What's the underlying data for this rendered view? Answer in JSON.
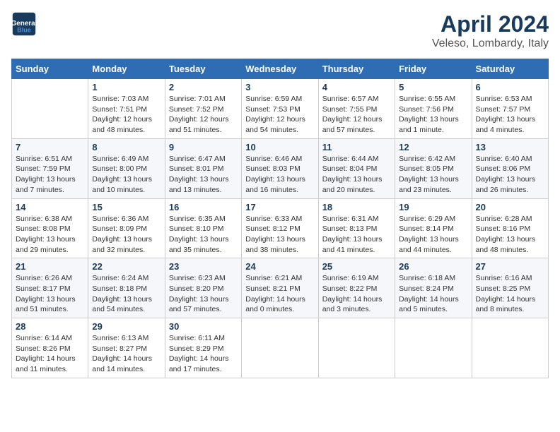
{
  "header": {
    "logo_line1": "General",
    "logo_line2": "Blue",
    "title": "April 2024",
    "subtitle": "Veleso, Lombardy, Italy"
  },
  "columns": [
    "Sunday",
    "Monday",
    "Tuesday",
    "Wednesday",
    "Thursday",
    "Friday",
    "Saturday"
  ],
  "weeks": [
    [
      {
        "day": "",
        "info": ""
      },
      {
        "day": "1",
        "info": "Sunrise: 7:03 AM\nSunset: 7:51 PM\nDaylight: 12 hours\nand 48 minutes."
      },
      {
        "day": "2",
        "info": "Sunrise: 7:01 AM\nSunset: 7:52 PM\nDaylight: 12 hours\nand 51 minutes."
      },
      {
        "day": "3",
        "info": "Sunrise: 6:59 AM\nSunset: 7:53 PM\nDaylight: 12 hours\nand 54 minutes."
      },
      {
        "day": "4",
        "info": "Sunrise: 6:57 AM\nSunset: 7:55 PM\nDaylight: 12 hours\nand 57 minutes."
      },
      {
        "day": "5",
        "info": "Sunrise: 6:55 AM\nSunset: 7:56 PM\nDaylight: 13 hours\nand 1 minute."
      },
      {
        "day": "6",
        "info": "Sunrise: 6:53 AM\nSunset: 7:57 PM\nDaylight: 13 hours\nand 4 minutes."
      }
    ],
    [
      {
        "day": "7",
        "info": "Sunrise: 6:51 AM\nSunset: 7:59 PM\nDaylight: 13 hours\nand 7 minutes."
      },
      {
        "day": "8",
        "info": "Sunrise: 6:49 AM\nSunset: 8:00 PM\nDaylight: 13 hours\nand 10 minutes."
      },
      {
        "day": "9",
        "info": "Sunrise: 6:47 AM\nSunset: 8:01 PM\nDaylight: 13 hours\nand 13 minutes."
      },
      {
        "day": "10",
        "info": "Sunrise: 6:46 AM\nSunset: 8:03 PM\nDaylight: 13 hours\nand 16 minutes."
      },
      {
        "day": "11",
        "info": "Sunrise: 6:44 AM\nSunset: 8:04 PM\nDaylight: 13 hours\nand 20 minutes."
      },
      {
        "day": "12",
        "info": "Sunrise: 6:42 AM\nSunset: 8:05 PM\nDaylight: 13 hours\nand 23 minutes."
      },
      {
        "day": "13",
        "info": "Sunrise: 6:40 AM\nSunset: 8:06 PM\nDaylight: 13 hours\nand 26 minutes."
      }
    ],
    [
      {
        "day": "14",
        "info": "Sunrise: 6:38 AM\nSunset: 8:08 PM\nDaylight: 13 hours\nand 29 minutes."
      },
      {
        "day": "15",
        "info": "Sunrise: 6:36 AM\nSunset: 8:09 PM\nDaylight: 13 hours\nand 32 minutes."
      },
      {
        "day": "16",
        "info": "Sunrise: 6:35 AM\nSunset: 8:10 PM\nDaylight: 13 hours\nand 35 minutes."
      },
      {
        "day": "17",
        "info": "Sunrise: 6:33 AM\nSunset: 8:12 PM\nDaylight: 13 hours\nand 38 minutes."
      },
      {
        "day": "18",
        "info": "Sunrise: 6:31 AM\nSunset: 8:13 PM\nDaylight: 13 hours\nand 41 minutes."
      },
      {
        "day": "19",
        "info": "Sunrise: 6:29 AM\nSunset: 8:14 PM\nDaylight: 13 hours\nand 44 minutes."
      },
      {
        "day": "20",
        "info": "Sunrise: 6:28 AM\nSunset: 8:16 PM\nDaylight: 13 hours\nand 48 minutes."
      }
    ],
    [
      {
        "day": "21",
        "info": "Sunrise: 6:26 AM\nSunset: 8:17 PM\nDaylight: 13 hours\nand 51 minutes."
      },
      {
        "day": "22",
        "info": "Sunrise: 6:24 AM\nSunset: 8:18 PM\nDaylight: 13 hours\nand 54 minutes."
      },
      {
        "day": "23",
        "info": "Sunrise: 6:23 AM\nSunset: 8:20 PM\nDaylight: 13 hours\nand 57 minutes."
      },
      {
        "day": "24",
        "info": "Sunrise: 6:21 AM\nSunset: 8:21 PM\nDaylight: 14 hours\nand 0 minutes."
      },
      {
        "day": "25",
        "info": "Sunrise: 6:19 AM\nSunset: 8:22 PM\nDaylight: 14 hours\nand 3 minutes."
      },
      {
        "day": "26",
        "info": "Sunrise: 6:18 AM\nSunset: 8:24 PM\nDaylight: 14 hours\nand 5 minutes."
      },
      {
        "day": "27",
        "info": "Sunrise: 6:16 AM\nSunset: 8:25 PM\nDaylight: 14 hours\nand 8 minutes."
      }
    ],
    [
      {
        "day": "28",
        "info": "Sunrise: 6:14 AM\nSunset: 8:26 PM\nDaylight: 14 hours\nand 11 minutes."
      },
      {
        "day": "29",
        "info": "Sunrise: 6:13 AM\nSunset: 8:27 PM\nDaylight: 14 hours\nand 14 minutes."
      },
      {
        "day": "30",
        "info": "Sunrise: 6:11 AM\nSunset: 8:29 PM\nDaylight: 14 hours\nand 17 minutes."
      },
      {
        "day": "",
        "info": ""
      },
      {
        "day": "",
        "info": ""
      },
      {
        "day": "",
        "info": ""
      },
      {
        "day": "",
        "info": ""
      }
    ]
  ]
}
